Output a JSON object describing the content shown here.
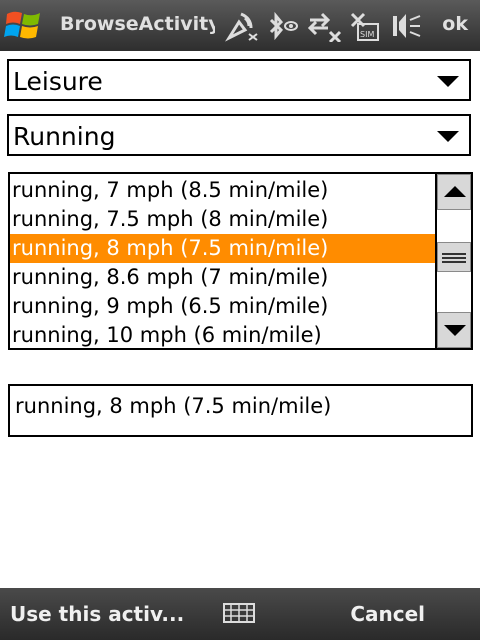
{
  "titlebar": {
    "title": "BrowseActivity",
    "ok_label": "ok",
    "icons": [
      "windows-start-icon",
      "signal-icon",
      "bluetooth-icon",
      "data-connection-icon",
      "no-sim-icon",
      "speaker-icon"
    ]
  },
  "category_combo": {
    "value": "Leisure"
  },
  "activity_combo": {
    "value": "Running"
  },
  "list": {
    "items": [
      "running, 7 mph (8.5 min/mile)",
      "running, 7.5 mph (8 min/mile)",
      "running, 8 mph (7.5 min/mile)",
      "running, 8.6 mph (7 min/mile)",
      "running, 9 mph (6.5 min/mile)",
      "running, 10 mph (6 min/mile)"
    ],
    "selected_index": 2
  },
  "selected_text": "running, 8 mph (7.5 min/mile)",
  "menubar": {
    "left_label": "Use this activ...",
    "right_label": "Cancel"
  },
  "colors": {
    "selection": "#ff8c00",
    "titlebar": "#3c3c3c"
  }
}
